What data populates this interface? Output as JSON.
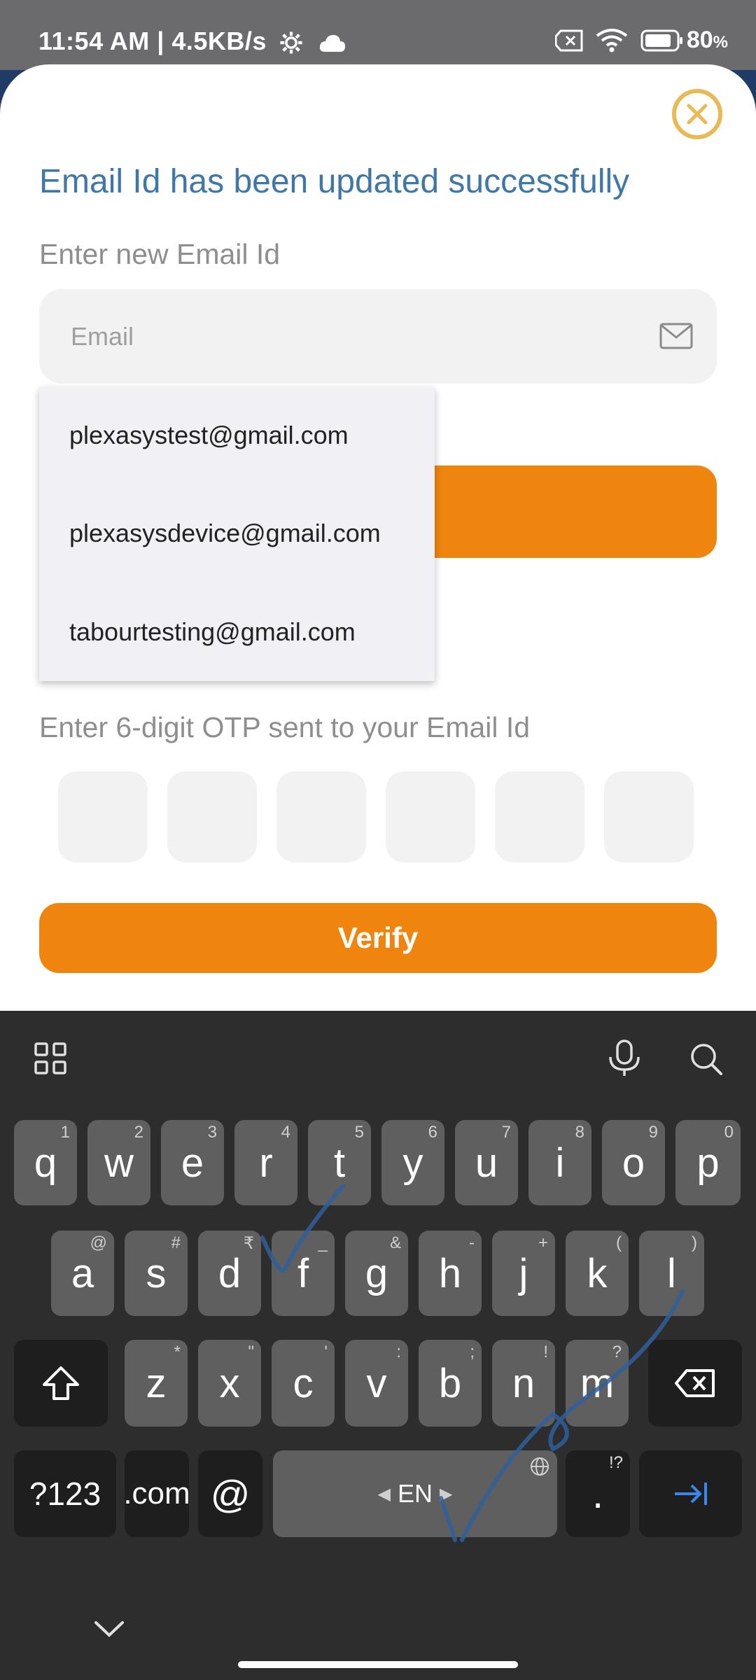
{
  "status_bar": {
    "time": "11:54 AM | 4.5KB/s",
    "battery": "80"
  },
  "sheet": {
    "headline": "Email Id has been updated successfully",
    "email_label": "Enter new Email Id",
    "email_placeholder": "Email",
    "suggestions": [
      "plexasystest@gmail.com",
      "plexasysdevice@gmail.com",
      "tabourtesting@gmail.com"
    ],
    "otp_label": "Enter 6-digit OTP sent to your Email Id",
    "verify_label": "Verify"
  },
  "keyboard": {
    "row1": [
      "q",
      "w",
      "e",
      "r",
      "t",
      "y",
      "u",
      "i",
      "o",
      "p"
    ],
    "row1_hints": [
      "1",
      "2",
      "3",
      "4",
      "5",
      "6",
      "7",
      "8",
      "9",
      "0"
    ],
    "row2": [
      "a",
      "s",
      "d",
      "f",
      "g",
      "h",
      "j",
      "k",
      "l"
    ],
    "row2_hints": [
      "@",
      "#",
      "₹",
      "_",
      "&",
      "-",
      "+",
      "(",
      ")"
    ],
    "row3": [
      "z",
      "x",
      "c",
      "v",
      "b",
      "n",
      "m"
    ],
    "row3_hints": [
      "*",
      "\"",
      "'",
      ":",
      ";",
      "!",
      "?"
    ],
    "symbols_label": "?123",
    "dotcom_label": ".com",
    "at_label": "@",
    "space_label": "EN",
    "period_label": ".",
    "period_hint": "!?"
  },
  "colors": {
    "accent_orange": "#ef840f",
    "headline_blue": "#3f77a8",
    "close_gold": "#e8b955"
  }
}
